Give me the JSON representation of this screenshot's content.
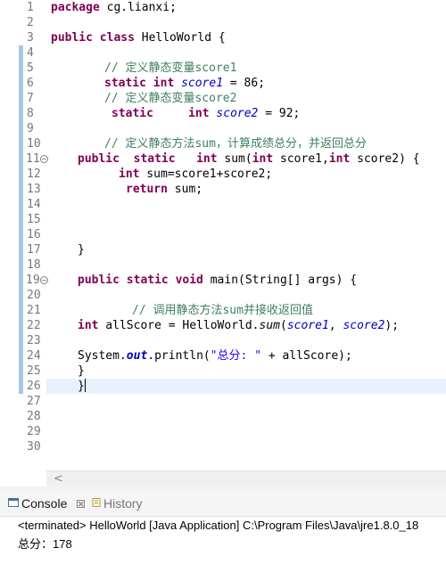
{
  "editor": {
    "line_numbers": [
      "1",
      "2",
      "3",
      "4",
      "5",
      "6",
      "7",
      "8",
      "9",
      "10",
      "11",
      "12",
      "13",
      "14",
      "15",
      "16",
      "17",
      "18",
      "19",
      "20",
      "21",
      "22",
      "23",
      "24",
      "25",
      "26",
      "27",
      "28",
      "29",
      "30"
    ],
    "lines": {
      "l1_kw": "package",
      "l1_rest": " cg.lianxi;",
      "l3_kw": "public class",
      "l3_rest": " HelloWorld {",
      "l5_comment": "// 定义静态变量score1",
      "l6_kw": "static int",
      "l6_var": "score1",
      "l6_rest": " = 86;",
      "l7_comment": "// 定义静态变量score2",
      "l8_kw1": "static",
      "l8_kw2": "int",
      "l8_var": "score2",
      "l8_rest": " = 92;",
      "l10_comment": "// 定义静态方法sum，计算成绩总分，并返回总分",
      "l11_kw1": "public",
      "l11_kw2": "static",
      "l11_kw3": "int",
      "l11_mid": " sum(",
      "l11_kw4": "int",
      "l11_mid2": " score1,",
      "l11_kw5": "int",
      "l11_rest": " score2) {",
      "l12_kw": "int",
      "l12_rest": " sum=score1+score2;",
      "l13_kw": "return",
      "l13_rest": " sum;",
      "l17_rest": "}",
      "l19_kw": "public static void",
      "l19_rest": " main(String[] args) {",
      "l21_comment": "// 调用静态方法sum并接收返回值",
      "l22_kw": "int",
      "l22_mid": " allScore = HelloWorld.",
      "l22_method": "sum",
      "l22_open": "(",
      "l22_var1": "score1",
      "l22_comma": ", ",
      "l22_var2": "score2",
      "l22_close": ");",
      "l24_pre": "System.",
      "l24_out": "out",
      "l24_mid": ".println(",
      "l24_str": "\"总分: \"",
      "l24_rest": " + allScore);",
      "l25_rest": "}",
      "l26_rest": "}"
    }
  },
  "console": {
    "tab_console": "Console",
    "tab_console_close": "☒",
    "tab_history": "History",
    "terminated": "<terminated> HelloWorld [Java Application] C:\\Program Files\\Java\\jre1.8.0_18",
    "output": "总分：178"
  }
}
